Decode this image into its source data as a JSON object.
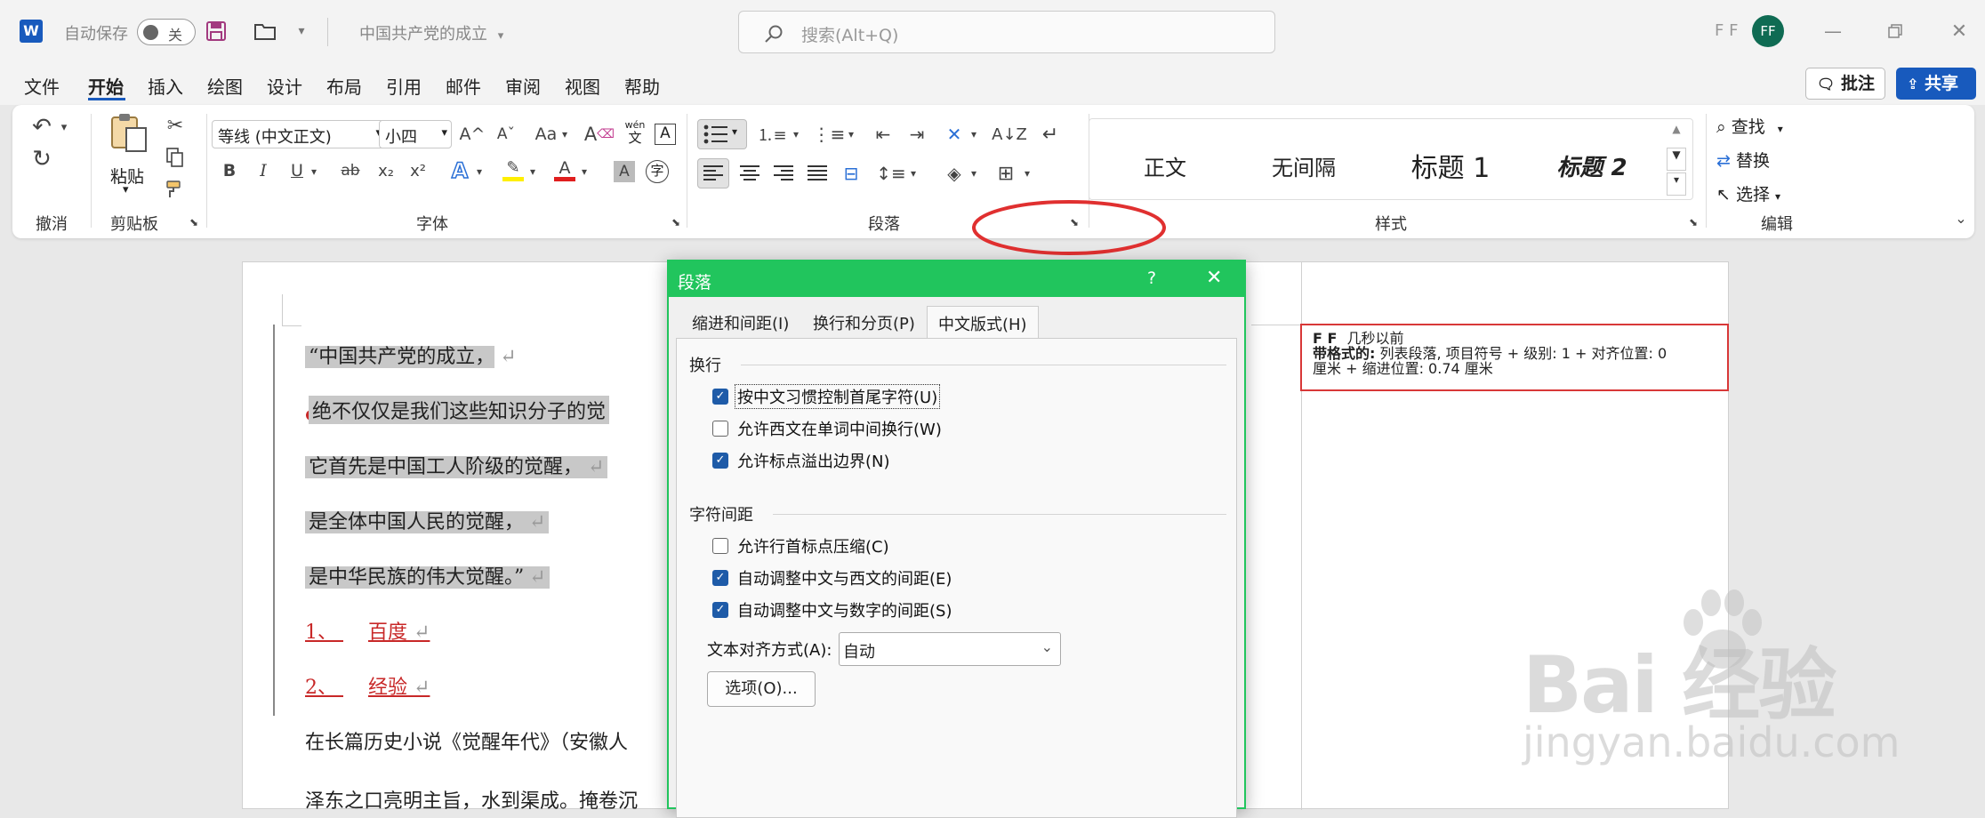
{
  "titlebar": {
    "app_icon": "W",
    "autosave_label": "自动保存",
    "autosave_state": "关",
    "doc_title": "中国共产党的成立",
    "search_placeholder": "搜索(Alt+Q)",
    "user_name": "F F",
    "avatar_initials": "FF"
  },
  "menu": {
    "items": [
      "文件",
      "开始",
      "插入",
      "绘图",
      "设计",
      "布局",
      "引用",
      "邮件",
      "审阅",
      "视图",
      "帮助"
    ],
    "active": "开始",
    "comment_button": "批注",
    "share_button": "共享"
  },
  "ribbon": {
    "groups": {
      "undo": "撤消",
      "clipboard": "剪贴板",
      "font": "字体",
      "paragraph": "段落",
      "styles": "样式",
      "edit": "编辑"
    },
    "paste_label": "粘贴",
    "font_name": "等线 (中文正文)",
    "font_size": "小四",
    "styles": [
      "正文",
      "无间隔",
      "标题 1",
      "标题 2"
    ],
    "edit_items": [
      "查找",
      "替换",
      "选择"
    ],
    "font_buttons": {
      "bold": "B",
      "italic": "I",
      "underline": "U",
      "strike": "ab",
      "subscript": "x₂",
      "superscript": "x²",
      "grow": "A^",
      "shrink": "Aˇ",
      "case": "Aa",
      "phonetic_top": "wén",
      "phonetic_bottom": "文"
    }
  },
  "document": {
    "bullets": [
      "“中国共产党的成立，",
      "绝不仅仅是我们这些知识分子的觉",
      "它首先是中国工人阶级的觉醒，",
      "是全体中国人民的觉醒，",
      "是中华民族的伟大觉醒。”"
    ],
    "numbered": [
      {
        "num": "1、",
        "text": "百度"
      },
      {
        "num": "2、",
        "text": "经验"
      }
    ],
    "body_lines": [
      "在长篇历史小说《觉醒年代》（安徽人",
      "泽东之口亮明主旨，水到渠成。掩卷沉"
    ],
    "para_mark": "↵"
  },
  "comment": {
    "author": "F F",
    "time": "几秒以前",
    "format_label": "带格式的:",
    "format_text_1": "列表段落, 项目符号 + 级别: 1 + 对齐位置:  0",
    "format_text_2": "厘米 + 缩进位置:  0.74 厘米"
  },
  "dialog": {
    "title": "段落",
    "help": "?",
    "close": "✕",
    "tabs": [
      "缩进和间距(I)",
      "换行和分页(P)",
      "中文版式(H)"
    ],
    "active_tab": "中文版式(H)",
    "section_wrap": "换行",
    "wrap_options": [
      {
        "label": "按中文习惯控制首尾字符(U)",
        "checked": true
      },
      {
        "label": "允许西文在单词中间换行(W)",
        "checked": false
      },
      {
        "label": "允许标点溢出边界(N)",
        "checked": true
      }
    ],
    "section_spacing": "字符间距",
    "spacing_options": [
      {
        "label": "允许行首标点压缩(C)",
        "checked": false
      },
      {
        "label": "自动调整中文与西文的间距(E)",
        "checked": true
      },
      {
        "label": "自动调整中文与数字的间距(S)",
        "checked": true
      }
    ],
    "align_label": "文本对齐方式(A):",
    "align_value": "自动",
    "options_button": "选项(O)..."
  },
  "watermark": {
    "line1": "Bai 经验",
    "line2": "jingyan.baidu.com"
  },
  "colors": {
    "accent": "#21c55d",
    "brand_blue": "#1e5ba8",
    "annotation_red": "#e03030"
  }
}
